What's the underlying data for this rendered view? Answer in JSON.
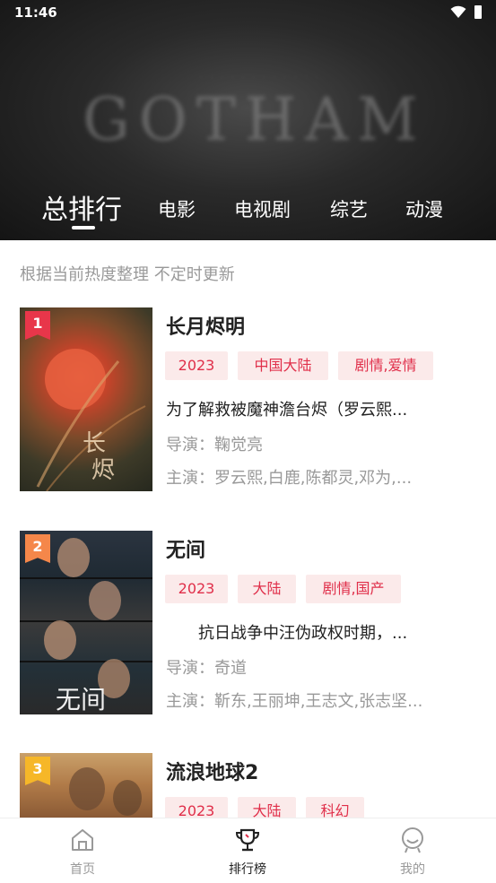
{
  "status_bar": {
    "time": "11:46"
  },
  "banner": {
    "title": "GOTHAM"
  },
  "tabs": [
    {
      "label": "总排行",
      "active": true
    },
    {
      "label": "电影",
      "active": false
    },
    {
      "label": "电视剧",
      "active": false
    },
    {
      "label": "综艺",
      "active": false
    },
    {
      "label": "动漫",
      "active": false
    }
  ],
  "notice": "根据当前热度整理 不定时更新",
  "items": [
    {
      "rank": "1",
      "title": "长月烬明",
      "tags": [
        "2023",
        "中国大陆",
        "剧情,爱情"
      ],
      "description": "为了解救被魔神澹台烬（罗云熙...",
      "director": "导演：鞠觉亮",
      "actors": "主演：罗云熙,白鹿,陈都灵,邓为,...",
      "rank_color": "#e8364a"
    },
    {
      "rank": "2",
      "title": "无间",
      "tags": [
        "2023",
        "大陆",
        "剧情,国产"
      ],
      "description": "　　抗日战争中汪伪政权时期，...",
      "director": "导演：奇道",
      "actors": "主演：靳东,王丽坤,王志文,张志坚...",
      "rank_color": "#f5874a"
    },
    {
      "rank": "3",
      "title": "流浪地球2",
      "tags": [
        "2023",
        "大陆",
        "科幻"
      ],
      "description": "",
      "director": "",
      "actors": "",
      "rank_color": "#f6b728"
    }
  ],
  "bottom_nav": [
    {
      "label": "首页",
      "icon": "home-icon",
      "active": false
    },
    {
      "label": "排行榜",
      "icon": "trophy-icon",
      "active": true
    },
    {
      "label": "我的",
      "icon": "profile-icon",
      "active": false
    }
  ],
  "colors": {
    "accent": "#e02f4a",
    "tag_bg": "#fbeaea",
    "muted": "#999999"
  }
}
